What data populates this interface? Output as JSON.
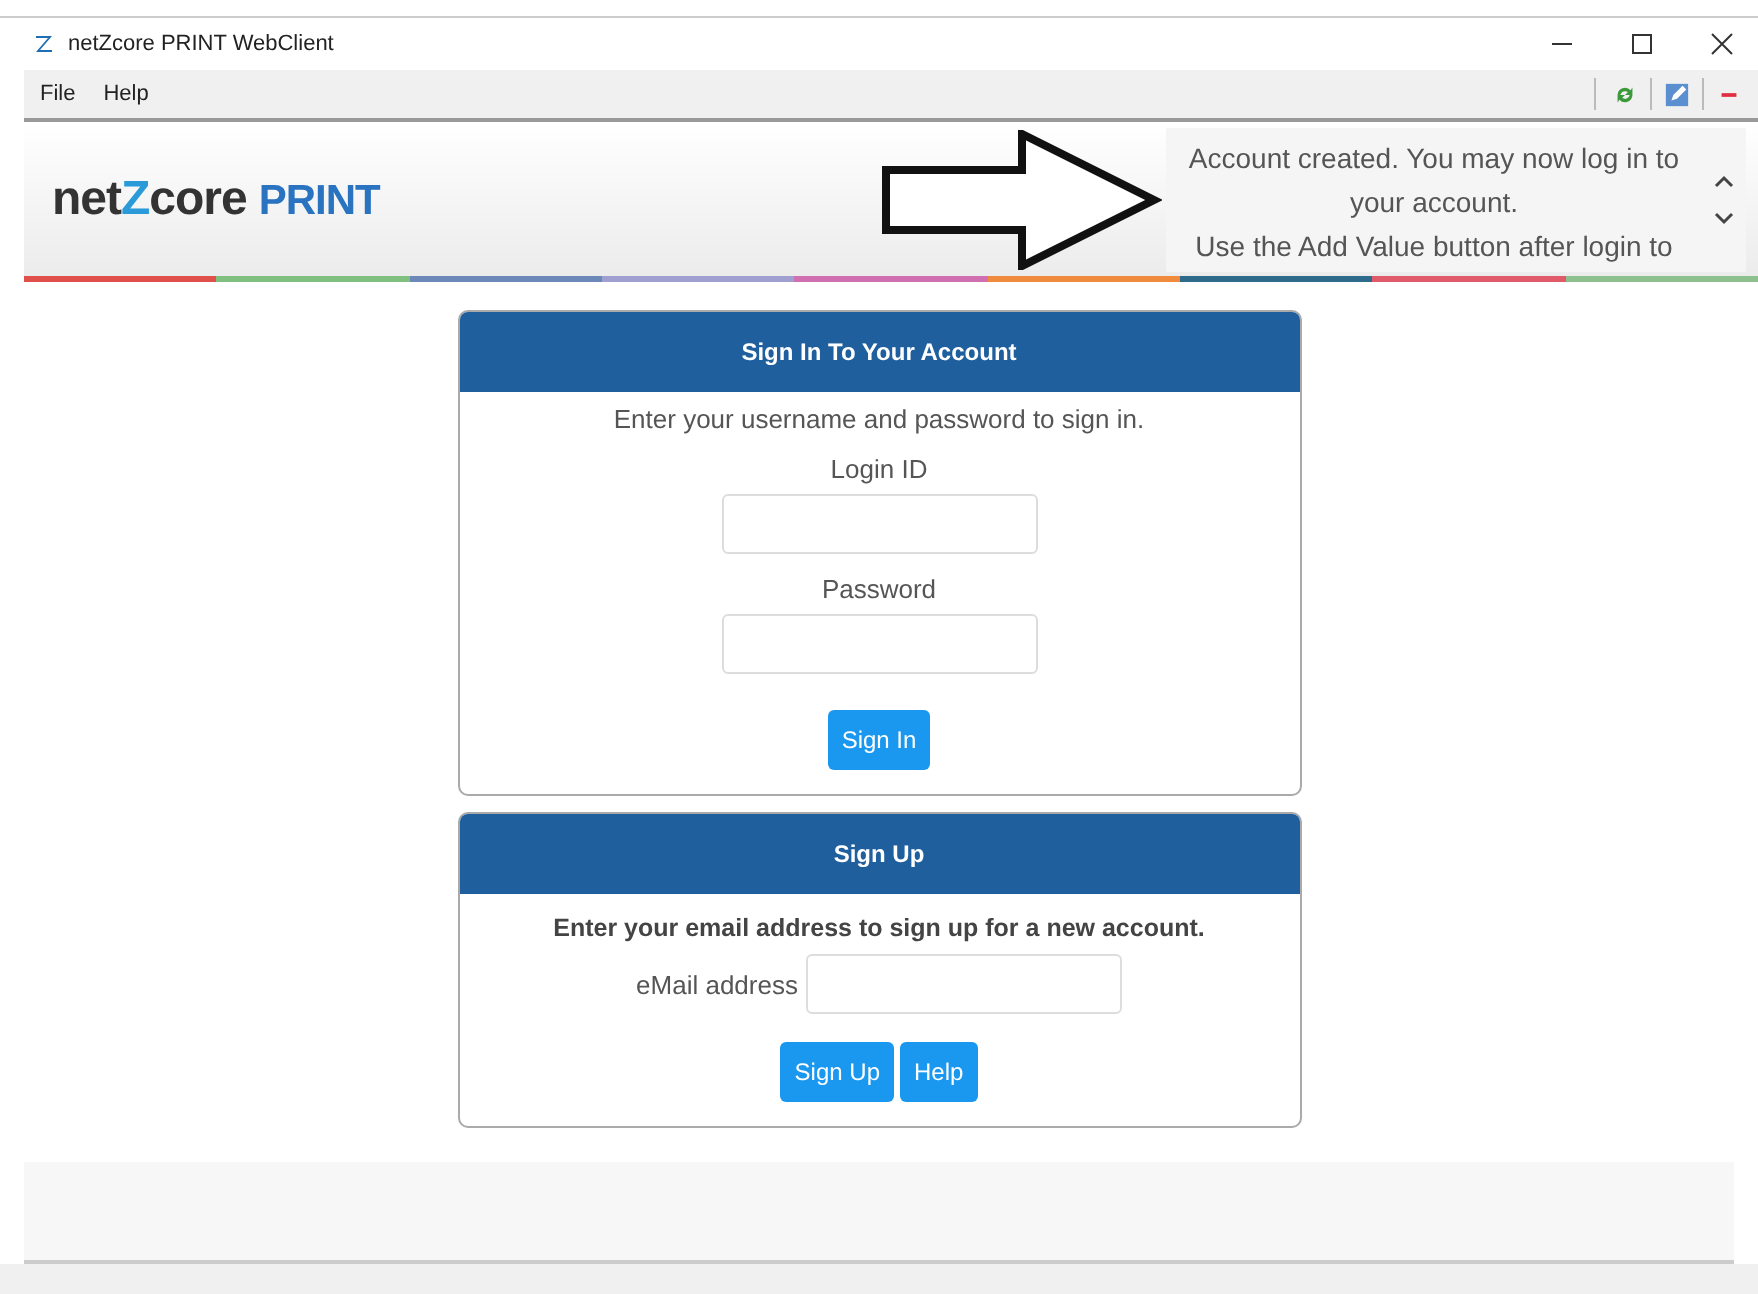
{
  "window": {
    "title": "netZcore PRINT WebClient"
  },
  "menu": [
    "File",
    "Help"
  ],
  "logo": {
    "prefix": "net",
    "mark": "Z",
    "suffix": "core",
    "product": "PRINT"
  },
  "message": {
    "lines": [
      "Account created. You may now log in to your account.",
      "Use the Add Value button after login to"
    ]
  },
  "sign_in": {
    "title": "Sign In To Your Account",
    "intro": "Enter your username and password to sign in.",
    "fields": [
      {
        "label": "Login ID"
      },
      {
        "label": "Password"
      }
    ],
    "button": "Sign In"
  },
  "sign_up": {
    "title": "Sign Up",
    "intro": "Enter your email address to sign up for a new account.",
    "field_label": "eMail address",
    "buttons": [
      "Sign Up",
      "Help"
    ]
  }
}
